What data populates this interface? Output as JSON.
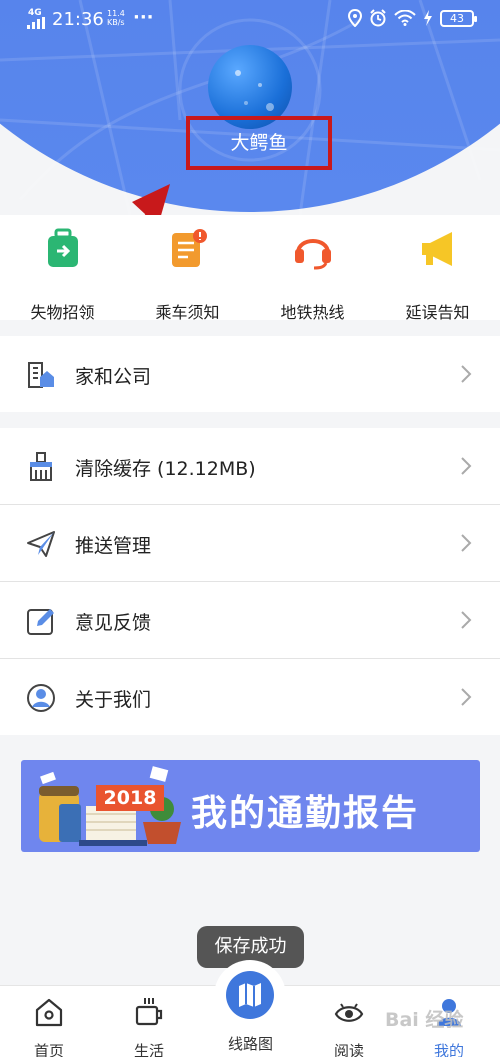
{
  "status_bar": {
    "network": "4G",
    "time": "21:36",
    "speed_value": "11.4",
    "speed_unit": "KB/s",
    "more": "···",
    "battery": "43"
  },
  "profile": {
    "username": "大鳄鱼"
  },
  "quick_actions": [
    {
      "label": "失物招领",
      "icon": "luggage-icon",
      "color": "#2bb673"
    },
    {
      "label": "乘车须知",
      "icon": "notice-icon",
      "color": "#f29a2e"
    },
    {
      "label": "地铁热线",
      "icon": "headset-icon",
      "color": "#f0582d"
    },
    {
      "label": "延误告知",
      "icon": "megaphone-icon",
      "color": "#f6c626"
    }
  ],
  "menu": [
    {
      "label": "家和公司",
      "icon": "home-office-icon"
    },
    {
      "label": "清除缓存  (12.12MB)",
      "icon": "broom-icon"
    },
    {
      "label": "推送管理",
      "icon": "paper-plane-icon"
    },
    {
      "label": "意见反馈",
      "icon": "edit-icon"
    },
    {
      "label": "关于我们",
      "icon": "user-circle-icon"
    }
  ],
  "banner": {
    "year": "2018",
    "title": "我的通勤报告"
  },
  "toast": "保存成功",
  "tabbar": [
    {
      "label": "首页",
      "icon": "home-icon"
    },
    {
      "label": "生活",
      "icon": "coffee-icon"
    },
    {
      "label": "线路图",
      "icon": "map-icon"
    },
    {
      "label": "阅读",
      "icon": "eye-icon"
    },
    {
      "label": "我的",
      "icon": "person-icon"
    }
  ],
  "watermark": "Bai 经验",
  "colors": {
    "header_blue": "#5582ea",
    "highlight_red": "#c8191b",
    "tab_active": "#3f77dc",
    "banner_bg": "#6f86ee"
  }
}
